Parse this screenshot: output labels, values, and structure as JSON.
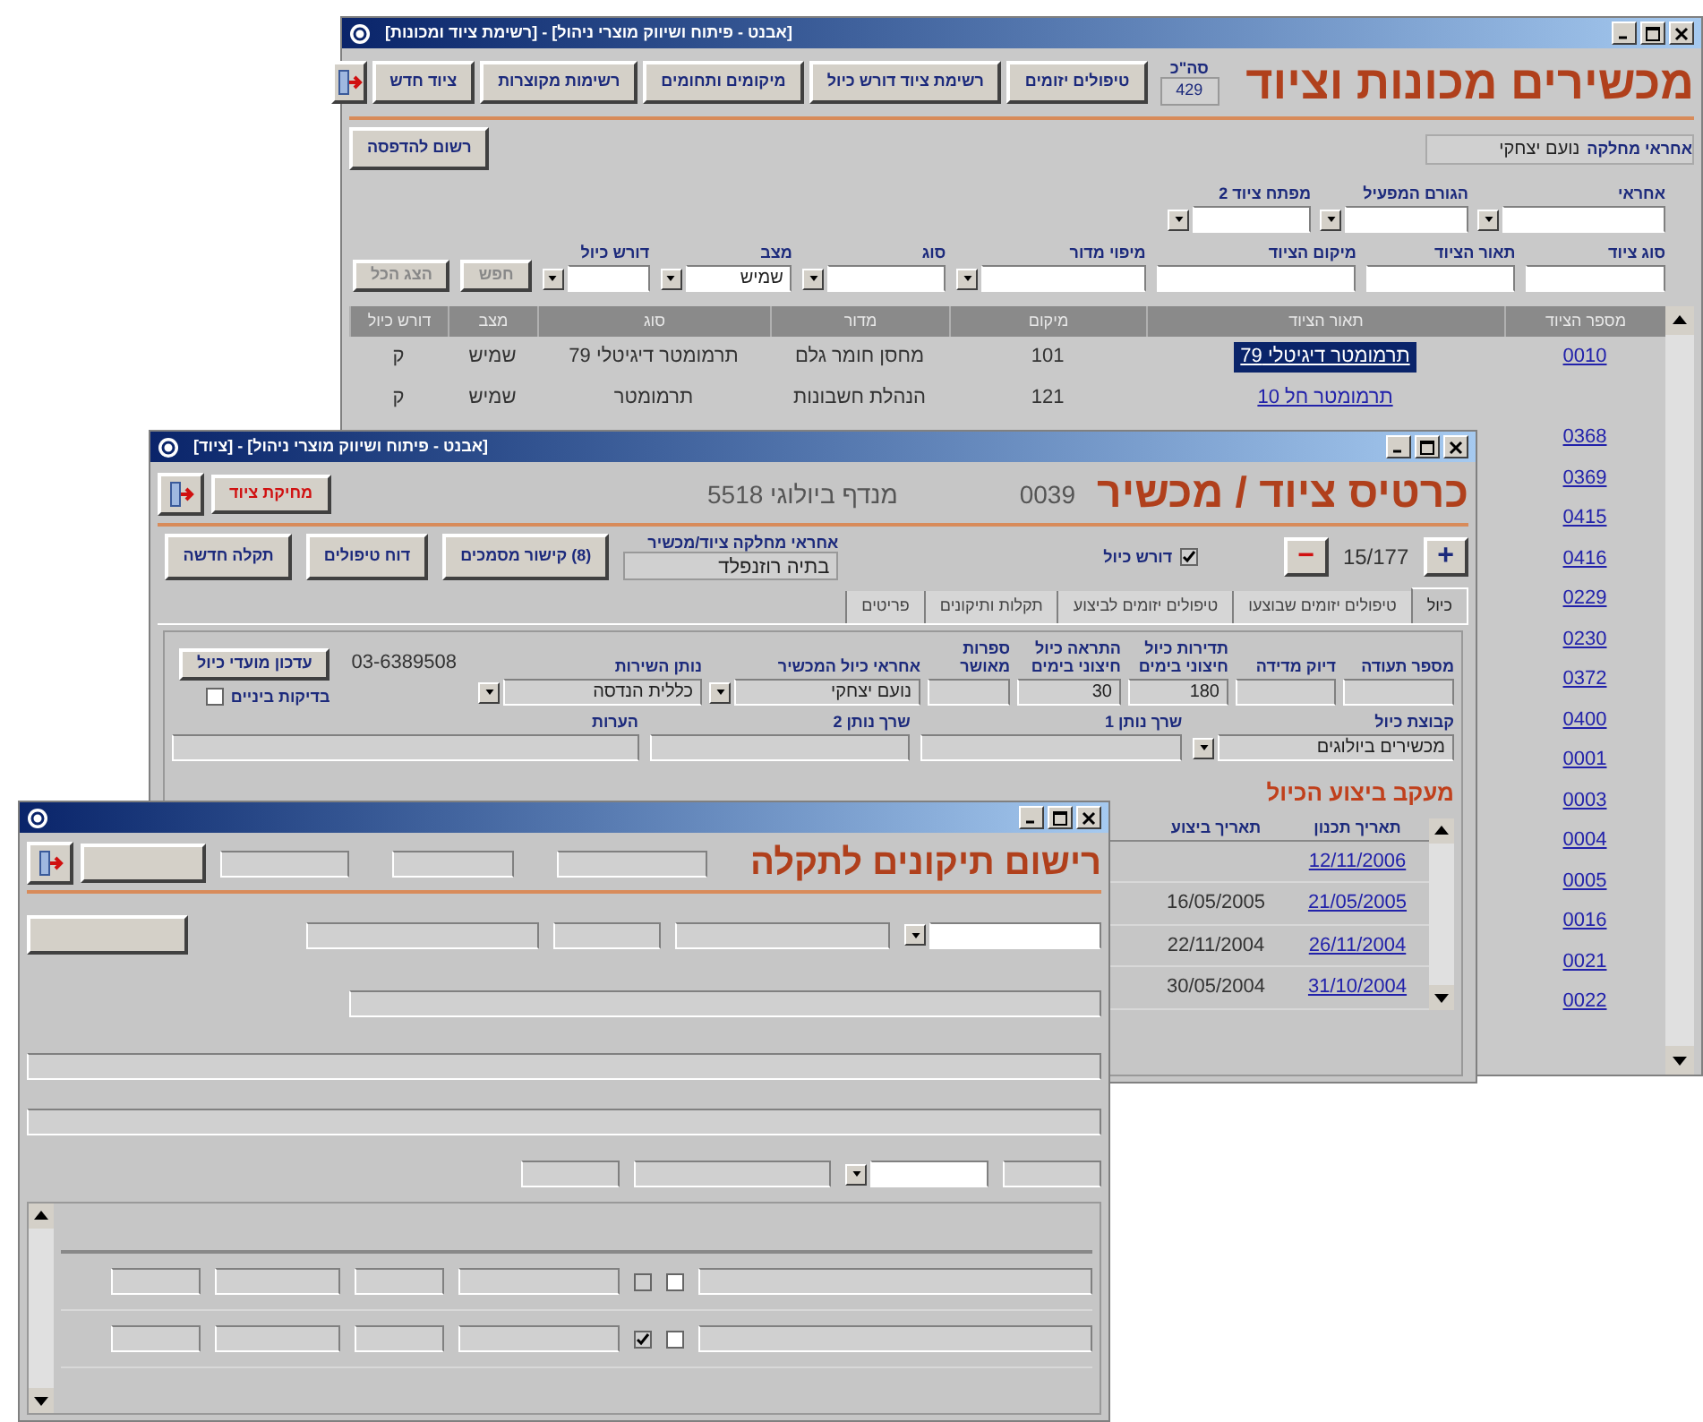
{
  "equipment_list_window": {
    "title": "[אבנט - פיתוח ושיווק מוצרי ניהול] - [רשימת ציוד ומכונות]",
    "heading": "מכשירים מכונות וציוד",
    "total_label": "סה\"כ",
    "total": "429",
    "buttons": [
      "טיפולים יזומים",
      "רשימת ציוד דורש כיול",
      "מיקומים ותחומים",
      "רשימות מקוצרות",
      "ציוד חדש"
    ],
    "print_button": "רשום להדפסה",
    "responsible_label": "אחראי מחלקה",
    "responsible": "נועם יצחקי",
    "filters": [
      [
        {
          "label": "אחראי",
          "kind": "combo"
        },
        {
          "label": "הגורם המפעיל",
          "kind": "combo"
        },
        {
          "label": "מפתח ציוד 2",
          "kind": "combo"
        }
      ],
      [
        {
          "label": "סוג ציוד",
          "kind": "text"
        },
        {
          "label": "תאור הציוד",
          "kind": "text"
        },
        {
          "label": "מיקום הציוד",
          "kind": "text"
        },
        {
          "label": "מיפוי מדור",
          "kind": "combo"
        },
        {
          "label": "סוג",
          "kind": "combo"
        },
        {
          "label": "מצב",
          "kind": "combo",
          "value": "שמיש"
        },
        {
          "label": "דורש כיול",
          "kind": "combo"
        }
      ]
    ],
    "action_buttons": [
      "חפש",
      "הצג הכל"
    ],
    "table": {
      "columns": [
        "מספר הציוד",
        "תאור הציוד",
        "מיקום",
        "מדור",
        "סוג",
        "מצב",
        "דורש כיול"
      ],
      "rows": [
        {
          "selected": true,
          "cells": [
            "0010",
            "תרמומטר דיגיטלי 79",
            "101",
            "מחסן חומר גלם",
            "תרמומטר דיגיטלי 79",
            "שמיש",
            "ק"
          ]
        },
        {
          "selected": false,
          "cells": [
            "",
            "תרמומטר חל 10",
            "121",
            "הנהלת חשבונות",
            "תרמומטר",
            "שמיש",
            "ק"
          ]
        },
        {
          "cells": [
            "0368"
          ]
        },
        {
          "cells": [
            "0369"
          ]
        },
        {
          "cells": [
            "0415"
          ]
        },
        {
          "cells": [
            "0416"
          ]
        },
        {
          "cells": [
            "0229"
          ]
        },
        {
          "cells": [
            "0230"
          ]
        },
        {
          "cells": [
            "0372"
          ]
        },
        {
          "cells": [
            "0400"
          ]
        },
        {
          "cells": [
            "0001"
          ]
        },
        {
          "cells": [
            "0003"
          ]
        },
        {
          "cells": [
            "0004"
          ]
        },
        {
          "cells": [
            "0005"
          ]
        },
        {
          "cells": [
            "0016"
          ]
        },
        {
          "cells": [
            "0021"
          ]
        },
        {
          "cells": [
            "0022"
          ]
        }
      ]
    }
  },
  "equipment_card_window": {
    "title": "[אבנט - פיתוח ושיווק מוצרי ניהול] - [ציוד]",
    "heading": "כרטיס ציוד / מכשיר",
    "equipment_number": "0039",
    "equipment_name": "מנדף ביולוגי 5518",
    "delete_button": "מחיקת ציוד",
    "next_button": "+",
    "record_position": "15/177",
    "previous_button": "−",
    "requires_calibration": {
      "label": "דורש כיול",
      "checked": true
    },
    "responsible_label": "אחראי מחלקה ציוד/מכשיר",
    "responsible": "בתיה רוזנפלד",
    "buttons": [
      "(8) קישור מסמכים",
      "דוח טיפולים",
      "תקלה חדשה"
    ],
    "tabs": [
      {
        "label": "כיול",
        "selected": true
      },
      {
        "label": "טיפולים יזומים שבוצעו",
        "selected": false
      },
      {
        "label": "טיפולים יזומים לביצוע",
        "selected": false
      },
      {
        "label": "תקלות ותיקונים",
        "selected": false
      },
      {
        "label": "פריטים",
        "selected": false
      }
    ],
    "fields": [
      {
        "label": "מספר תעודה",
        "kind": "text"
      },
      {
        "label": "דיוק מדידה",
        "kind": "text"
      },
      {
        "label": "תדירות כיול חיצוני בימים",
        "kind": "text",
        "value": "180"
      },
      {
        "label": "התראה כיול חיצוני בימים",
        "kind": "text",
        "value": "30"
      },
      {
        "label": "ספרות מאושר",
        "kind": "text"
      },
      {
        "label": "אחראי כיול המכשיר",
        "kind": "combo",
        "value": "נועם יצחקי"
      },
      {
        "label": "נותן השירות",
        "kind": "combo",
        "value": "כללית הנדסה"
      }
    ],
    "phone": "03-6389508",
    "update_button": "עדכון מועדי כיול",
    "intermediate_checks": {
      "label": "בדיקות ביניים",
      "checked": false
    },
    "fields_2": [
      {
        "label": "קבוצת כיול",
        "kind": "combo",
        "value": "מכשירים ביולוגים"
      },
      {
        "label": "שרך נותן 1",
        "kind": "text"
      },
      {
        "label": "שרך נותן 2",
        "kind": "text"
      },
      {
        "label": "הערות",
        "kind": "text"
      }
    ],
    "tracking": {
      "title": "מעקב ביצוע הכיול",
      "columns": [
        "תאריך תכנון",
        "תאריך ביצוע"
      ],
      "rows": [
        [
          "12/11/2006",
          ""
        ],
        [
          "21/05/2005",
          "16/05/2005"
        ],
        [
          "26/11/2004",
          "22/11/2004"
        ],
        [
          "31/10/2004",
          "30/05/2004"
        ]
      ]
    }
  },
  "repair_window": {
    "heading": "רישום תיקונים לתקלה",
    "rows": [
      {
        "checked": false,
        "confirmed": false
      },
      {
        "checked": true,
        "confirmed": false
      }
    ]
  }
}
